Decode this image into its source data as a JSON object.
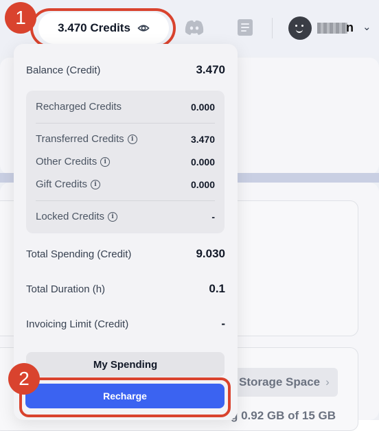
{
  "header": {
    "credits_label": "3.470 Credits",
    "user_suffix": "n"
  },
  "background": {
    "storage_button": "Storage Space",
    "usage_text": "g 0.92 GB of 15 GB"
  },
  "panel": {
    "balance": {
      "label": "Balance (Credit)",
      "value": "3.470"
    },
    "breakdown": [
      {
        "label": "Recharged Credits",
        "value": "0.000",
        "info": false
      },
      {
        "label": "Transferred Credits",
        "value": "3.470",
        "info": true
      },
      {
        "label": "Other Credits",
        "value": "0.000",
        "info": true
      },
      {
        "label": "Gift Credits",
        "value": "0.000",
        "info": true
      },
      {
        "label": "Locked Credits",
        "value": "-",
        "info": true
      }
    ],
    "total_spending": {
      "label": "Total Spending (Credit)",
      "value": "9.030"
    },
    "total_duration": {
      "label": "Total Duration (h)",
      "value": "0.1"
    },
    "invoicing_limit": {
      "label": "Invoicing Limit (Credit)",
      "value": "-"
    },
    "my_spending_label": "My Spending",
    "recharge_label": "Recharge"
  },
  "annotations": {
    "step1": "1",
    "step2": "2"
  },
  "colors": {
    "accent": "#3b63f1",
    "annotation": "#d9432e"
  },
  "icons": [
    "eye-icon",
    "discord-icon",
    "document-icon",
    "info-icon",
    "chevron-down-icon",
    "chevron-right-icon"
  ]
}
